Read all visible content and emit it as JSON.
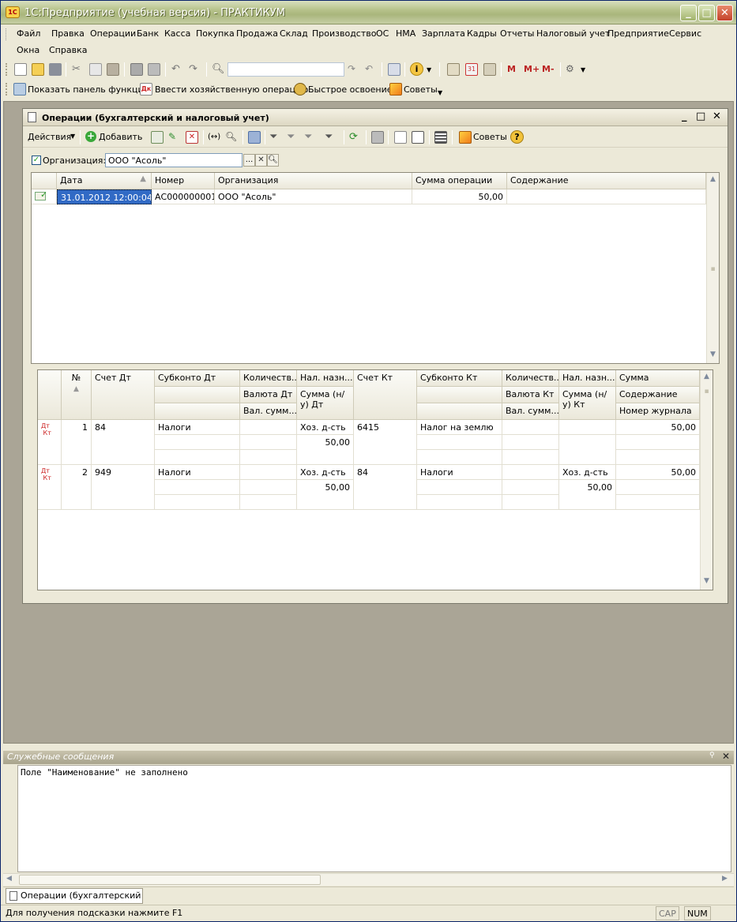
{
  "window": {
    "title": "1С:Предприятие (учебная версия) - ПРАКТИКУМ",
    "app_icon_text": "1С"
  },
  "menu": [
    "Файл",
    "Правка",
    "Операции",
    "Банк",
    "Касса",
    "Покупка",
    "Продажа",
    "Склад",
    "Производство",
    "ОС",
    "НМА",
    "Зарплата",
    "Кадры",
    "Отчеты",
    "Налоговый учет",
    "Предприятие",
    "Сервис",
    "Окна",
    "Справка"
  ],
  "toolbar2": {
    "m": "M",
    "mplus": "M+",
    "mminus": "M-"
  },
  "toolbar3": {
    "show_panel": "Показать панель функций",
    "enter_op": "Ввести хозяйственную операцию",
    "quick": "Быстрое освоение",
    "tips": "Советы"
  },
  "form": {
    "title": "Операции (бухгалтерский и налоговый учет)",
    "toolbar": {
      "actions": "Действия",
      "add": "Добавить",
      "tips": "Советы"
    },
    "org_label": "Организация:",
    "org_value": "ООО \"Асоль\"",
    "ops_table": {
      "headers": [
        "Дата",
        "Номер",
        "Организация",
        "Сумма операции",
        "Содержание"
      ],
      "rows": [
        {
          "date": "31.01.2012 12:00:04",
          "number": "АС000000001",
          "org": "ООО \"Асоль\"",
          "sum": "50,00",
          "content": ""
        }
      ]
    },
    "entries_table": {
      "headers": {
        "num": "№",
        "dt_account": "Счет Дт",
        "dt_subconto": "Субконто Дт",
        "dt_qty": "Количеств...",
        "dt_currency": "Валюта Дт",
        "dt_cursum": "Вал. сумм...",
        "dt_tax": "Нал. назн....",
        "dt_nu_sum": "Сумма (н/у) Дт",
        "kt_account": "Счет Кт",
        "kt_subconto": "Субконто Кт",
        "kt_qty": "Количеств...",
        "kt_currency": "Валюта Кт",
        "kt_cursum": "Вал. сумм...",
        "kt_tax": "Нал. назн....",
        "kt_nu_sum": "Сумма (н/у) Кт",
        "sum": "Сумма",
        "content": "Содержание",
        "journal": "Номер журнала"
      },
      "rows": [
        {
          "n": "1",
          "dt": "84",
          "dt_sub": "Налоги",
          "dt_tax": "Хоз. д-сть",
          "dt_nu": "50,00",
          "kt": "6415",
          "kt_sub": "Налог на землю",
          "kt_tax": "",
          "kt_nu": "",
          "sum": "50,00"
        },
        {
          "n": "2",
          "dt": "949",
          "dt_sub": "Налоги",
          "dt_tax": "Хоз. д-сть",
          "dt_nu": "50,00",
          "kt": "84",
          "kt_sub": "Налоги",
          "kt_tax": "Хоз. д-сть",
          "kt_nu": "50,00",
          "sum": "50,00"
        }
      ]
    }
  },
  "messages": {
    "title": "Служебные сообщения",
    "text": "Поле \"Наименование\" не заполнено"
  },
  "taskbar": {
    "tab": "Операции (бухгалтерский и..."
  },
  "status": {
    "hint": "Для получения подсказки нажмите F1",
    "cap": "CAP",
    "num": "NUM"
  }
}
